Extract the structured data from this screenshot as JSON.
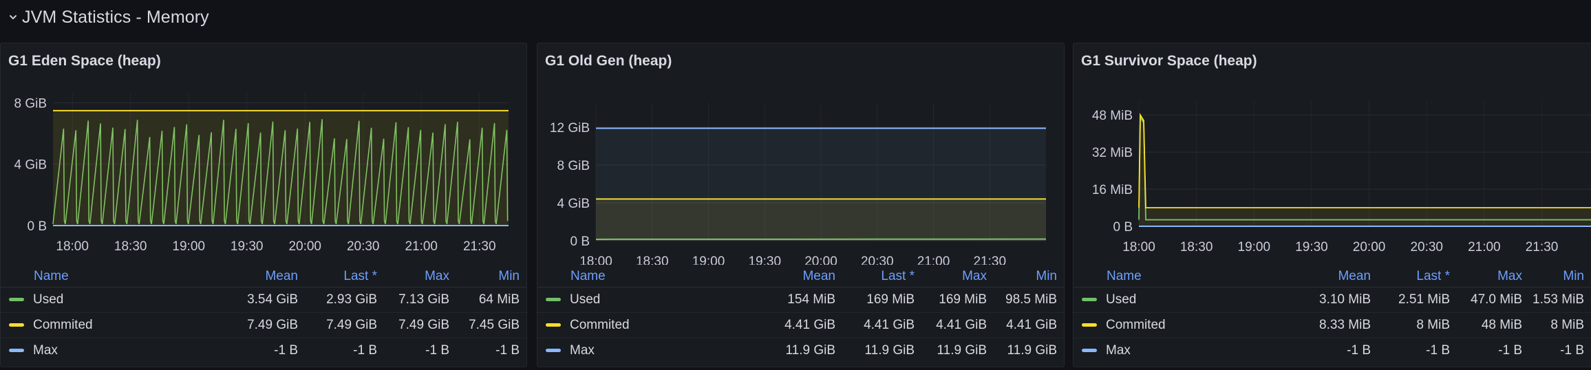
{
  "row": {
    "title": "JVM Statistics - Memory"
  },
  "colors": {
    "used": "#73bf69",
    "commited": "#fade2a",
    "max": "#8ab8ff"
  },
  "legend_headers": {
    "name": "Name",
    "mean": "Mean",
    "last": "Last *",
    "max": "Max",
    "min": "Min"
  },
  "panels": [
    {
      "title": "G1 Eden Space (heap)",
      "rows": [
        {
          "name": "Used",
          "mean": "3.54 GiB",
          "last": "2.93 GiB",
          "max": "7.13 GiB",
          "min": "64 MiB"
        },
        {
          "name": "Commited",
          "mean": "7.49 GiB",
          "last": "7.49 GiB",
          "max": "7.49 GiB",
          "min": "7.45 GiB"
        },
        {
          "name": "Max",
          "mean": "-1 B",
          "last": "-1 B",
          "max": "-1 B",
          "min": "-1 B"
        }
      ]
    },
    {
      "title": "G1 Old Gen (heap)",
      "rows": [
        {
          "name": "Used",
          "mean": "154 MiB",
          "last": "169 MiB",
          "max": "169 MiB",
          "min": "98.5 MiB"
        },
        {
          "name": "Commited",
          "mean": "4.41 GiB",
          "last": "4.41 GiB",
          "max": "4.41 GiB",
          "min": "4.41 GiB"
        },
        {
          "name": "Max",
          "mean": "11.9 GiB",
          "last": "11.9 GiB",
          "max": "11.9 GiB",
          "min": "11.9 GiB"
        }
      ]
    },
    {
      "title": "G1 Survivor Space (heap)",
      "rows": [
        {
          "name": "Used",
          "mean": "3.10 MiB",
          "last": "2.51 MiB",
          "max": "47.0 MiB",
          "min": "1.53 MiB"
        },
        {
          "name": "Commited",
          "mean": "8.33 MiB",
          "last": "8 MiB",
          "max": "48 MiB",
          "min": "8 MiB"
        },
        {
          "name": "Max",
          "mean": "-1 B",
          "last": "-1 B",
          "max": "-1 B",
          "min": "-1 B"
        }
      ]
    }
  ],
  "chart_data": [
    {
      "type": "line",
      "title": "G1 Eden Space (heap)",
      "x_ticks": [
        "18:00",
        "18:30",
        "19:00",
        "19:30",
        "20:00",
        "20:30",
        "21:00",
        "21:30"
      ],
      "y_ticks": [
        "0 B",
        "4 GiB",
        "8 GiB"
      ],
      "y_tick_values": [
        0,
        4,
        8
      ],
      "ylim": [
        0,
        8.2
      ],
      "x_range_minutes": [
        -10,
        225
      ],
      "y_unit": "GiB",
      "series": [
        {
          "name": "Used",
          "color": "#73bf69",
          "pattern": "sawtooth",
          "cycles": 37,
          "low": 0.1,
          "high": 7.0
        },
        {
          "name": "Commited",
          "color": "#fade2a",
          "values": [
            7.49,
            7.49
          ],
          "fill": true
        },
        {
          "name": "Max",
          "color": "#8ab8ff",
          "values": [
            0,
            0
          ]
        }
      ]
    },
    {
      "type": "line",
      "title": "G1 Old Gen (heap)",
      "x_ticks": [
        "18:00",
        "18:30",
        "19:00",
        "19:30",
        "20:00",
        "20:30",
        "21:00",
        "21:30"
      ],
      "y_ticks": [
        "0 B",
        "4 GiB",
        "8 GiB",
        "12 GiB"
      ],
      "y_tick_values": [
        0,
        4,
        8,
        12
      ],
      "ylim": [
        0,
        13.9
      ],
      "x_range_minutes": [
        0,
        240
      ],
      "y_unit": "GiB",
      "series": [
        {
          "name": "Used",
          "color": "#73bf69",
          "values": [
            0.15,
            0.17
          ]
        },
        {
          "name": "Commited",
          "color": "#fade2a",
          "values": [
            4.41,
            4.41
          ],
          "fill": true
        },
        {
          "name": "Max",
          "color": "#8ab8ff",
          "values": [
            11.9,
            11.9
          ],
          "fill": true
        }
      ]
    },
    {
      "type": "line",
      "title": "G1 Survivor Space (heap)",
      "x_ticks": [
        "18:00",
        "18:30",
        "19:00",
        "19:30",
        "20:00",
        "20:30",
        "21:00",
        "21:30"
      ],
      "y_ticks": [
        "0 B",
        "16 MiB",
        "32 MiB",
        "48 MiB"
      ],
      "y_tick_values": [
        0,
        16,
        32,
        48
      ],
      "ylim": [
        0,
        51
      ],
      "x_range_minutes": [
        0,
        236
      ],
      "y_unit": "MiB",
      "series": [
        {
          "name": "Used",
          "color": "#73bf69",
          "spike": 47.0,
          "baseline": 2.8
        },
        {
          "name": "Commited",
          "color": "#fade2a",
          "spike": 48,
          "baseline": 8
        },
        {
          "name": "Max",
          "color": "#8ab8ff",
          "values": [
            0,
            0
          ]
        }
      ]
    }
  ]
}
